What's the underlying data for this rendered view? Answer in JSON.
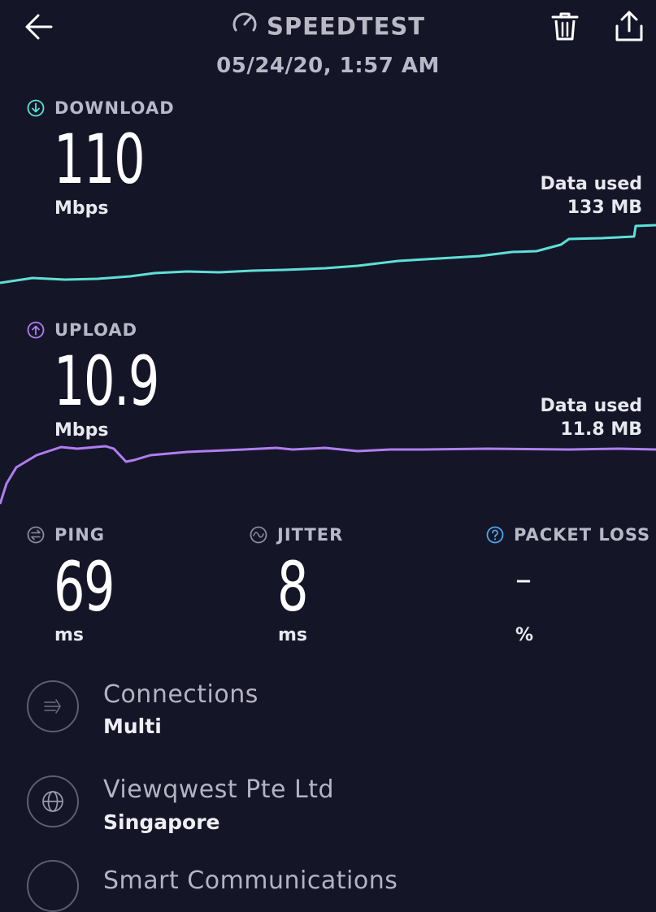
{
  "header": {
    "title": "SPEEDTEST",
    "datetime": "05/24/20, 1:57 AM",
    "icons": [
      "back-arrow-icon",
      "speedometer-icon",
      "trash-icon",
      "share-icon"
    ]
  },
  "download": {
    "label": "DOWNLOAD",
    "value": "110",
    "unit": "Mbps",
    "data_used_label": "Data used",
    "data_used_value": "133 MB",
    "color": "#5ee0d6"
  },
  "upload": {
    "label": "UPLOAD",
    "value": "10.9",
    "unit": "Mbps",
    "data_used_label": "Data used",
    "data_used_value": "11.8 MB",
    "color": "#b07ef0"
  },
  "metrics": {
    "ping": {
      "label": "PING",
      "value": "69",
      "unit": "ms"
    },
    "jitter": {
      "label": "JITTER",
      "value": "8",
      "unit": "ms"
    },
    "packet_loss": {
      "label": "PACKET LOSS",
      "value": "–",
      "unit": "%"
    }
  },
  "connections": {
    "title": "Connections",
    "value": "Multi"
  },
  "server": {
    "title": "Viewqwest Pte Ltd",
    "location": "Singapore"
  },
  "next_row": {
    "title": "Smart Communications"
  },
  "colors": {
    "background": "#151528",
    "info": "#4aa8f0"
  }
}
